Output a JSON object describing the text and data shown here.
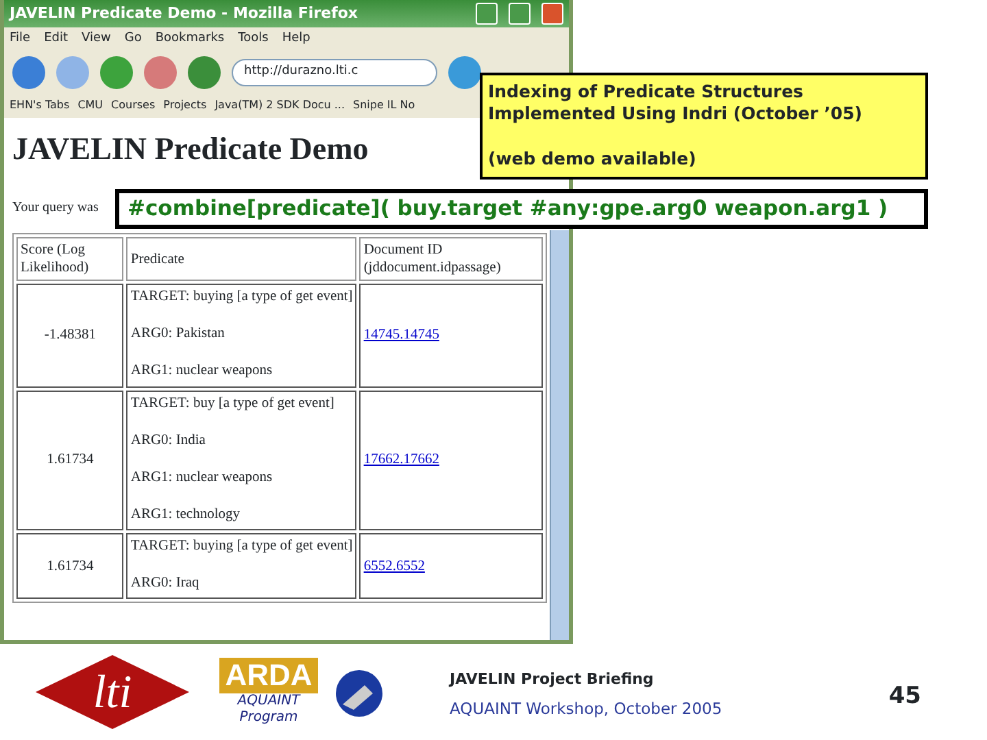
{
  "browser": {
    "title": "JAVELIN Predicate Demo - Mozilla Firefox",
    "menu": [
      "File",
      "Edit",
      "View",
      "Go",
      "Bookmarks",
      "Tools",
      "Help"
    ],
    "url": "http://durazno.lti.c",
    "bookmarks": [
      "EHN's Tabs",
      "CMU",
      "Courses",
      "Projects",
      "Java(TM) 2 SDK Docu ...",
      "Snipe IL No"
    ],
    "page": {
      "heading": "JAVELIN Predicate Demo",
      "query_label": "Your query was",
      "columns": [
        "Score (Log Likelihood)",
        "Predicate",
        "Document ID (jddocument.idpassage)"
      ],
      "rows": [
        {
          "score": "-1.48381",
          "predicate": [
            "TARGET: buying [a type of get event]",
            "ARG0: Pakistan",
            "ARG1: nuclear weapons"
          ],
          "document_id": "14745.14745"
        },
        {
          "score": "1.61734",
          "predicate": [
            "TARGET: buy [a type of get event]",
            "ARG0: India",
            "ARG1: nuclear weapons",
            "ARG1: technology"
          ],
          "document_id": "17662.17662"
        },
        {
          "score": "1.61734",
          "predicate": [
            "TARGET: buying [a type of get event]",
            "ARG0: Iraq"
          ],
          "document_id": "6552.6552"
        }
      ]
    }
  },
  "callout": {
    "title": "Indexing of Predicate Structures Implemented Using Indri (October ’05)",
    "note": "(web demo available)"
  },
  "query": "#combine[predicate]( buy.target #any:gpe.arg0 weapon.arg1 )",
  "footer": {
    "lti_logo": "lti",
    "arda_logo": "ARDA",
    "program": "AQUAINT Program",
    "briefing": "JAVELIN Project Briefing",
    "workshop": "AQUAINT Workshop, October 2005",
    "page_number": "45"
  }
}
